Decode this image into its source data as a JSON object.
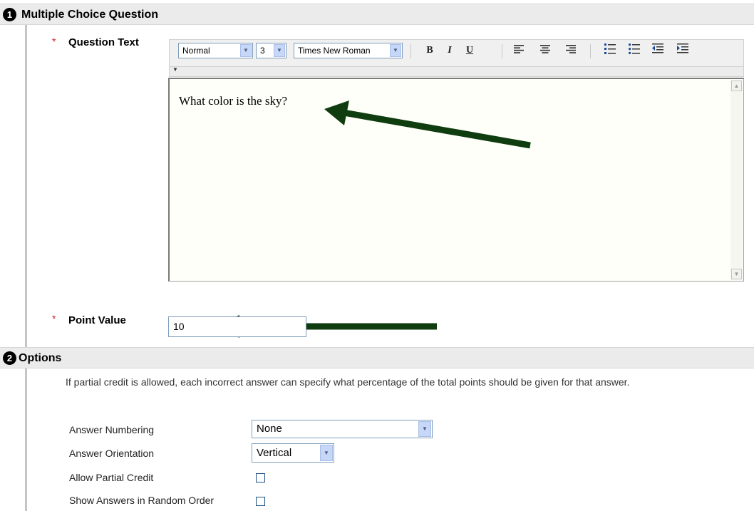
{
  "question_section": {
    "step": "1",
    "title": "Multiple Choice Question",
    "question_text_label": "Question Text",
    "point_value_label": "Point Value",
    "point_value": "10"
  },
  "toolbar": {
    "style_value": "Normal",
    "size_value": "3",
    "font_value": "Times New Roman",
    "bold": "B",
    "italic": "I",
    "underline": "U"
  },
  "editor": {
    "content": "What color is the sky?"
  },
  "options_section": {
    "step": "2",
    "title": "Options",
    "description": "If partial credit is allowed, each incorrect answer can specify what percentage of the total points should be given for that answer.",
    "answer_numbering_label": "Answer Numbering",
    "answer_numbering_value": "None",
    "answer_orientation_label": "Answer Orientation",
    "answer_orientation_value": "Vertical",
    "allow_partial_credit_label": "Allow Partial Credit",
    "allow_partial_credit_checked": false,
    "random_order_label": "Show Answers in Random Order",
    "random_order_checked": false
  },
  "annotation_color": "#0f3d0f"
}
